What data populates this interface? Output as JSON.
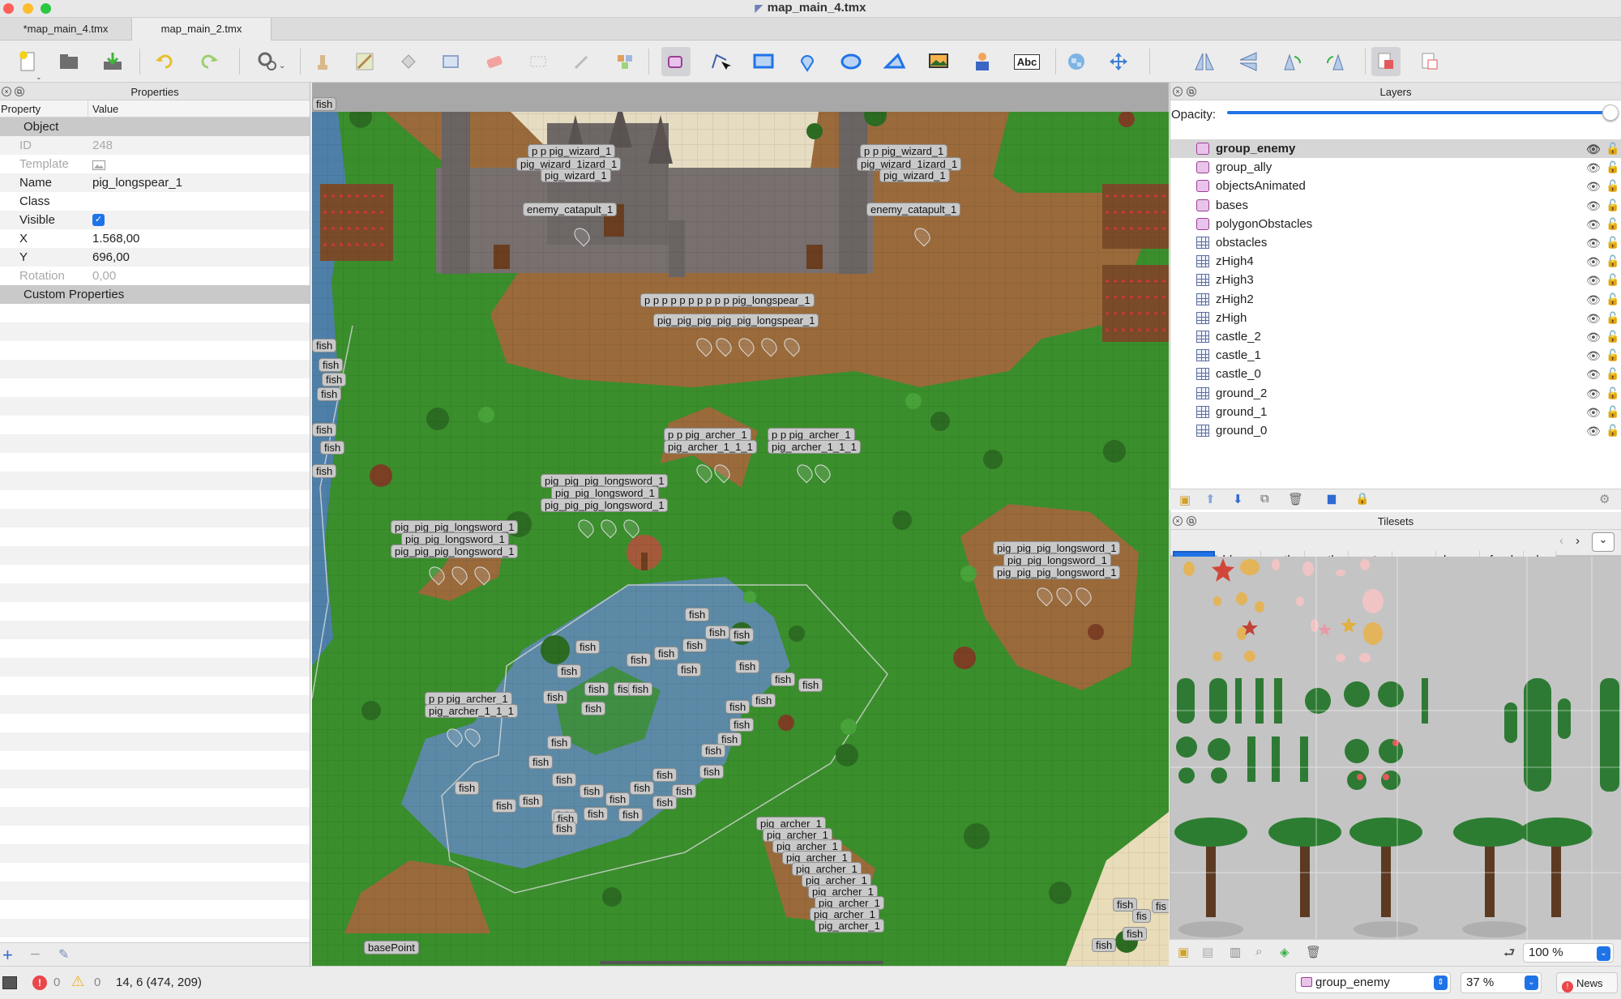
{
  "window": {
    "title": "map_main_4.tmx"
  },
  "tabs": [
    {
      "label": "*map_main_4.tmx"
    },
    {
      "label": "map_main_2.tmx"
    }
  ],
  "toolbar": {
    "file_tools": [
      "new-map-icon",
      "open-icon",
      "save-icon"
    ],
    "history_tools": [
      "undo-icon",
      "redo-icon"
    ],
    "tools": [
      "stamp-icon",
      "terrain-brush-icon",
      "fill-icon",
      "rectangle-select-icon",
      "eraser-icon",
      "select-icon",
      "magic-wand-icon",
      "same-tile-icon",
      "select-objects-icon",
      "edit-polygons-icon",
      "insert-rectangle-icon",
      "insert-point-icon",
      "insert-ellipse-icon",
      "insert-polygon-icon",
      "insert-tile-icon",
      "insert-template-icon",
      "insert-text-icon",
      "world-tool-icon",
      "move-icon"
    ],
    "text_tool_label": "Abc",
    "transform_tools": [
      "flip-horizontal-icon",
      "flip-vertical-icon",
      "rotate-left-icon",
      "rotate-right-icon",
      "random-mode-icon",
      "wang-fill-icon"
    ]
  },
  "properties": {
    "panel_title": "Properties",
    "col_property": "Property",
    "col_value": "Value",
    "group_object": "Object",
    "id": {
      "label": "ID",
      "value": "248"
    },
    "template": {
      "label": "Template",
      "value": ""
    },
    "name": {
      "label": "Name",
      "value": "pig_longspear_1"
    },
    "class": {
      "label": "Class",
      "value": ""
    },
    "visible": {
      "label": "Visible",
      "value": true
    },
    "x": {
      "label": "X",
      "value": "1.568,00"
    },
    "y": {
      "label": "Y",
      "value": "696,00"
    },
    "rotation": {
      "label": "Rotation",
      "value": "0,00"
    },
    "group_custom": "Custom Properties"
  },
  "map_labels": {
    "top_left": "fish",
    "wizard_l1": "p p pig_wizard_1",
    "wizard_l2": "pig_wizard_1izard_1",
    "wizard_l3": "pig_wizard_1",
    "wizard_r1": "p p pig_wizard_1",
    "wizard_r2": "pig_wizard_1izard_1",
    "wizard_r3": "pig_wizard_1",
    "catapult_l": "enemy_catapult_1",
    "catapult_r": "enemy_catapult_1",
    "longspear_1": "p p p p p p p p p p pig_longspear_1",
    "longspear_2": "pig_pig_pig_pig_pig_longspear_1",
    "archer_a1": "p p pig_archer_1",
    "archer_a2": "pig_archer_1_1_1",
    "archer_b1": "p p pig_archer_1",
    "archer_b2": "pig_archer_1_1_1",
    "longsword_a1": "pig_pig_pig_longsword_1",
    "longsword_a2": "pig_pig_longsword_1",
    "longsword_a3": "pig_pig_pig_longsword_1",
    "longsword_b1": "pig_pig_pig_longsword_1",
    "longsword_b2": "pig_pig_longsword_1",
    "longsword_b3": "pig_pig_pig_longsword_1",
    "longsword_c1": "pig_pig_pig_longsword_1",
    "longsword_c2": "pig_pig_longsword_1",
    "longsword_c3": "pig_pig_pig_longsword_1",
    "archer_c1": "p p pig_archer_1",
    "archer_c2": "pig_archer_1_1_1",
    "archer_stack": [
      "pig_archer_1",
      "pig_archer_1",
      "pig_archer_1",
      "pig_archer_1",
      "pig_archer_1",
      "pig_archer_1",
      "pig_archer_1",
      "pig_archer_1",
      "pig_archer_1",
      "pig_archer_1"
    ],
    "fish": "fish",
    "fish_partial": "fis",
    "base_point": "basePoint"
  },
  "layers": {
    "panel_title": "Layers",
    "opacity_label": "Opacity:",
    "opacity_value": 1.0,
    "items": [
      {
        "name": "group_enemy",
        "type": "object"
      },
      {
        "name": "group_ally",
        "type": "object"
      },
      {
        "name": "objectsAnimated",
        "type": "object"
      },
      {
        "name": "bases",
        "type": "object"
      },
      {
        "name": "polygonObstacles",
        "type": "object"
      },
      {
        "name": "obstacles",
        "type": "tile"
      },
      {
        "name": "zHigh4",
        "type": "tile"
      },
      {
        "name": "zHigh3",
        "type": "tile"
      },
      {
        "name": "zHigh2",
        "type": "tile"
      },
      {
        "name": "zHigh",
        "type": "tile"
      },
      {
        "name": "castle_2",
        "type": "tile"
      },
      {
        "name": "castle_1",
        "type": "tile"
      },
      {
        "name": "castle_0",
        "type": "tile"
      },
      {
        "name": "ground_2",
        "type": "tile"
      },
      {
        "name": "ground_1",
        "type": "tile"
      },
      {
        "name": "ground_0",
        "type": "tile"
      }
    ]
  },
  "tilesets": {
    "panel_title": "Tilesets",
    "tabs": [
      "beac...",
      "blac...",
      "castl...",
      "castl...",
      "cont...",
      "crops",
      "deco...",
      "food",
      "plar"
    ],
    "zoom": "100 %"
  },
  "status": {
    "errors": "0",
    "warnings": "0",
    "coords": "14, 6 (474, 209)",
    "current_layer": "group_enemy",
    "zoom": "37 %",
    "news": "News"
  },
  "colors": {
    "accent": "#1f73e8",
    "grass": "#3a8e2c",
    "dirt": "#9a6a3b",
    "water": "#5c8aa6"
  }
}
